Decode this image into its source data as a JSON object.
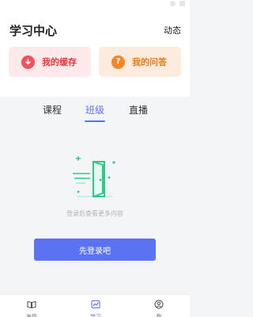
{
  "header": {
    "title": "学习中心",
    "dynamics_label": "动态"
  },
  "quick_cards": {
    "cache": {
      "label": "我的缓存",
      "icon": "download-icon"
    },
    "qa": {
      "label": "我的问答",
      "icon": "question-icon",
      "glyph": "?"
    }
  },
  "tabs": [
    {
      "label": "课程"
    },
    {
      "label": "班级",
      "active": true
    },
    {
      "label": "直播"
    }
  ],
  "empty_state": {
    "message": "登录后查看更多内容",
    "illustration": "door-icon"
  },
  "login_button_label": "先登录吧",
  "bottom_nav": [
    {
      "label": "发现",
      "icon": "book-icon"
    },
    {
      "label": "学习",
      "icon": "chart-icon",
      "active": true
    },
    {
      "label": "我",
      "icon": "user-icon"
    }
  ],
  "colors": {
    "accent": "#5b73f2",
    "cache_accent": "#f0515a",
    "qa_accent": "#f68528",
    "illustration_green": "#2fc98b"
  }
}
